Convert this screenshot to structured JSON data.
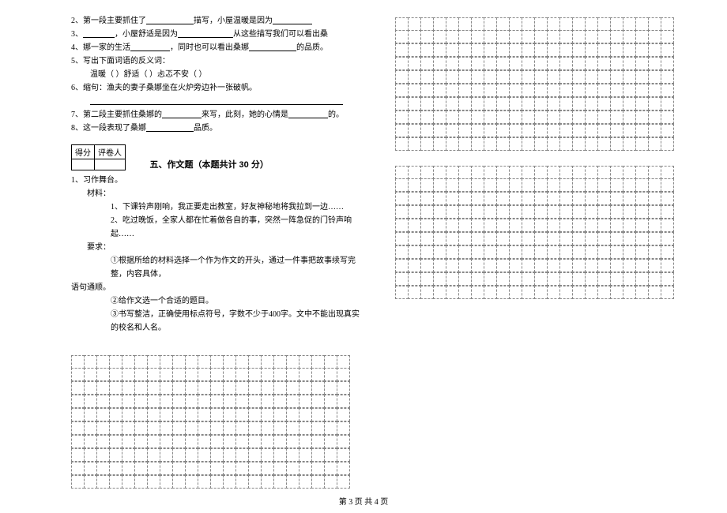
{
  "questions": {
    "q2": {
      "num": "2、",
      "a": "第一段主要抓住了",
      "b": "描写，小屋温暖是因为"
    },
    "q3": {
      "num": "3、",
      "a": "，小屋舒适是因为",
      "b": "从这些描写我们可以看出桑"
    },
    "q4": {
      "num": "4、",
      "a": "娜一家的生活",
      "b": "，同时也可以看出桑娜",
      "c": "的品质。"
    },
    "q5": {
      "num": "5、",
      "a": "写出下面词语的反义词："
    },
    "q5b": {
      "a": "温暖（        ）舒适（        ）忐忑不安（        ）"
    },
    "q6": {
      "num": "6、",
      "a": "缩句：渔夫的妻子桑娜坐在火炉旁边补一张破帆。"
    },
    "q6line": "",
    "q7": {
      "num": "7、",
      "a": "第二段主要抓住桑娜的",
      "b": "来写，此刻，她的心情是",
      "c": "的。"
    },
    "q8": {
      "num": "8、",
      "a": "这一段表现了桑娜",
      "b": "品质。"
    }
  },
  "score_box": {
    "left": "得分",
    "right": "评卷人"
  },
  "section5": {
    "title": "五、作文题（本题共计 30 分）",
    "q1": "1、习作舞台。",
    "m_label": "材料：",
    "m1": "1、下课铃声刚响，我正要走出教室，好友神秘地将我拉到一边……",
    "m2": "2、吃过晚饭，全家人都在忙着做各自的事，突然一阵急促的门铃声响起……",
    "req_label": "要求：",
    "r1": "①根据所给的材料选择一个作为作文的开头，通过一件事把故事续写完整，内容具体，",
    "r1b": "语句通顺。",
    "r2": "②给作文选一个合适的题目。",
    "r3": "③书写整洁，正确使用标点符号，字数不少于400字。文中不能出现真实的校名和人名。"
  },
  "grids": {
    "left": {
      "rows": 10,
      "cols": 22
    },
    "right1": {
      "rows": 10,
      "cols": 22
    },
    "right2": {
      "rows": 10,
      "cols": 22
    }
  },
  "footer": "第 3 页 共 4 页"
}
